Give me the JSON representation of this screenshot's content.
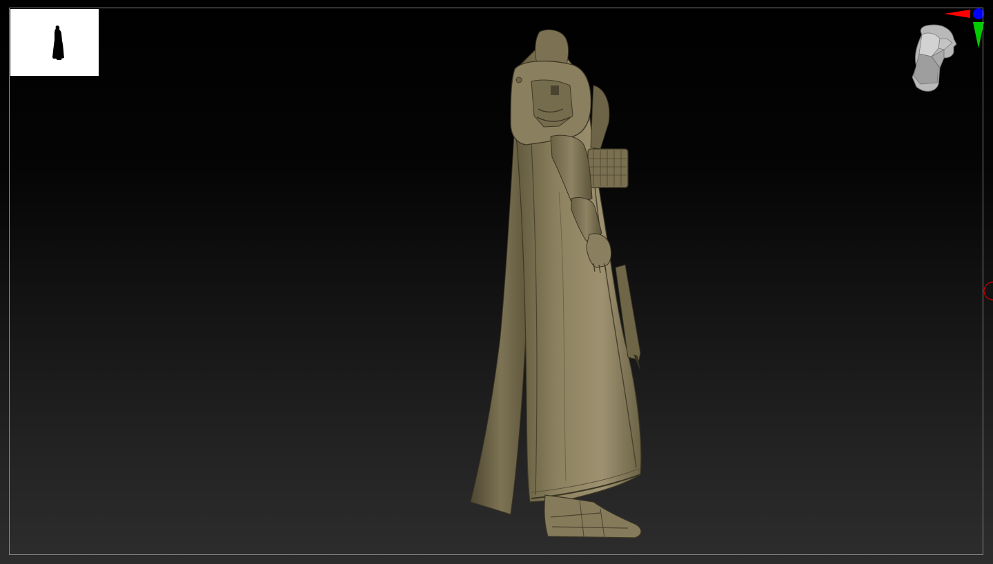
{
  "viewport": {
    "name": "3D viewport",
    "background_top": "#000000",
    "background_bottom": "#2d2d2d",
    "frame_color": "#8a8a8a"
  },
  "navigator": {
    "icon": "figure-silhouette-thumbnail",
    "background": "#ffffff"
  },
  "model": {
    "icon": "robed-figure-sculpt",
    "material_color": "#8b7f5a"
  },
  "gizmo": {
    "icon": "orientation-head-gizmo",
    "axis_colors": {
      "x": "#ff0000",
      "y": "#00cc00",
      "z": "#0000ff"
    }
  },
  "edge_marker": {
    "icon": "red-circle-marker",
    "color": "#cc0000"
  }
}
